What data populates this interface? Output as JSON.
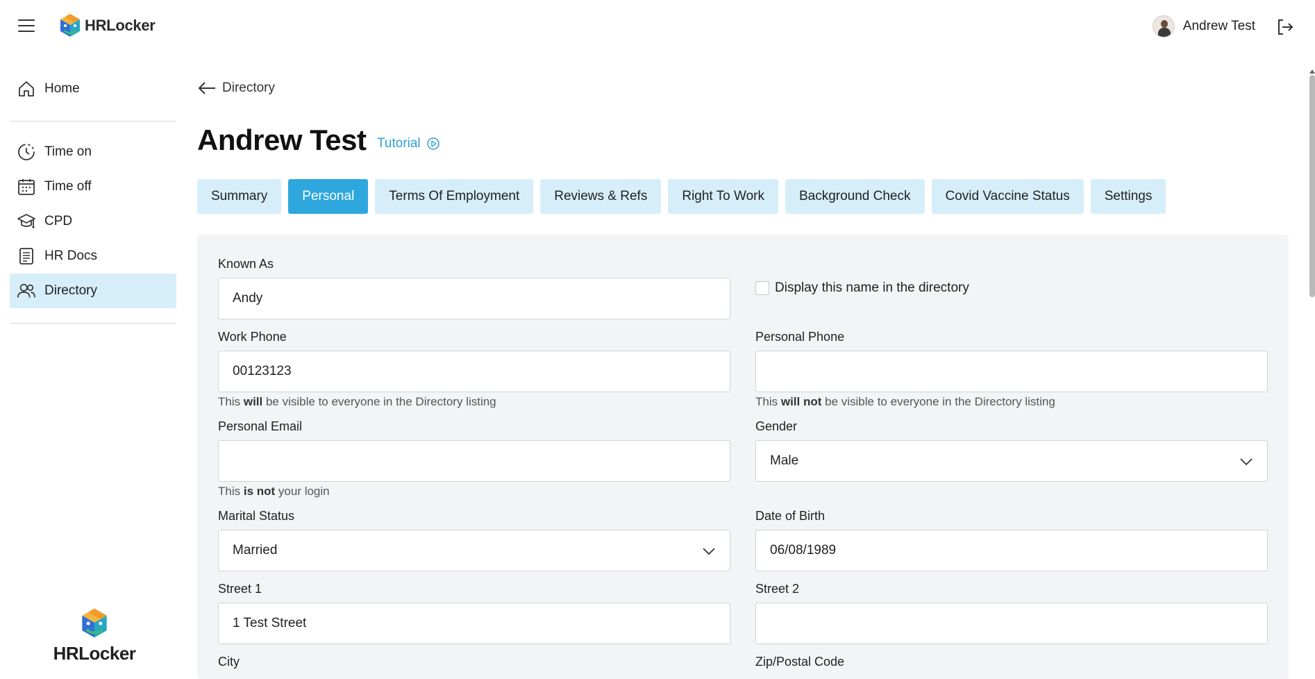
{
  "app": {
    "name": "HRLocker",
    "colors": {
      "accent": "#2ea7df",
      "accent_light": "#d6eef9",
      "panel": "#f3f4f6"
    }
  },
  "header": {
    "menu_icon": "hamburger-menu-icon",
    "user_name": "Andrew Test",
    "logout_icon": "logout-icon"
  },
  "sidebar": {
    "items": [
      {
        "label": "Home",
        "icon": "home-icon"
      },
      {
        "label": "Time on",
        "icon": "clock-icon"
      },
      {
        "label": "Time off",
        "icon": "calendar-icon"
      },
      {
        "label": "CPD",
        "icon": "graduation-cap-icon"
      },
      {
        "label": "HR Docs",
        "icon": "document-icon"
      },
      {
        "label": "Directory",
        "icon": "people-icon",
        "active": true
      }
    ],
    "footer_logo": "HRLocker"
  },
  "page": {
    "back_label": "Directory",
    "title": "Andrew Test",
    "tutorial_label": "Tutorial"
  },
  "tabs": [
    {
      "label": "Summary"
    },
    {
      "label": "Personal",
      "active": true
    },
    {
      "label": "Terms Of Employment"
    },
    {
      "label": "Reviews & Refs"
    },
    {
      "label": "Right To Work"
    },
    {
      "label": "Background Check"
    },
    {
      "label": "Covid Vaccine Status"
    },
    {
      "label": "Settings"
    }
  ],
  "form": {
    "known_as": {
      "label": "Known As",
      "value": "Andy"
    },
    "display_name_checkbox": {
      "label": "Display this name in the directory",
      "checked": false
    },
    "work_phone": {
      "label": "Work Phone",
      "value": "00123123",
      "hint_pre": "This ",
      "hint_bold": "will",
      "hint_post": " be visible to everyone in the Directory listing"
    },
    "personal_phone": {
      "label": "Personal Phone",
      "value": "",
      "hint_pre": "This ",
      "hint_bold": "will not",
      "hint_post": " be visible to everyone in the Directory listing"
    },
    "personal_email": {
      "label": "Personal Email",
      "value": "",
      "hint_pre": "This ",
      "hint_bold": "is not",
      "hint_post": " your login"
    },
    "gender": {
      "label": "Gender",
      "value": "Male"
    },
    "marital_status": {
      "label": "Marital Status",
      "value": "Married"
    },
    "date_of_birth": {
      "label": "Date of Birth",
      "value": "06/08/1989"
    },
    "street1": {
      "label": "Street 1",
      "value": "1 Test Street"
    },
    "street2": {
      "label": "Street 2",
      "value": ""
    },
    "city": {
      "label": "City"
    },
    "zip": {
      "label": "Zip/Postal Code"
    }
  }
}
